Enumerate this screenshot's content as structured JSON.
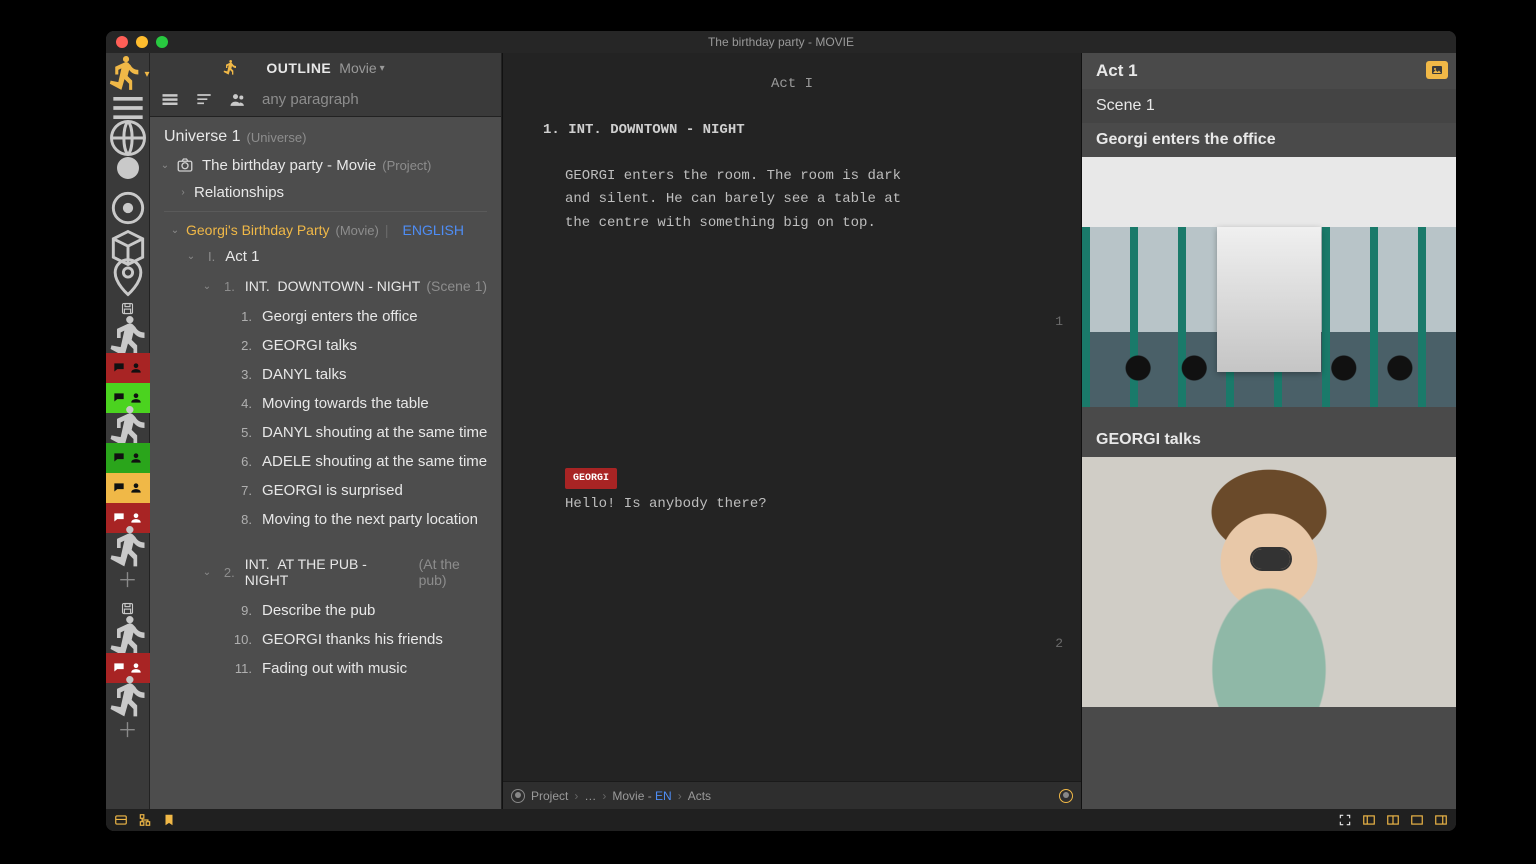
{
  "window": {
    "title": "The birthday party - MOVIE"
  },
  "outline": {
    "header_label": "OUTLINE",
    "header_mode": "Movie",
    "search_placeholder": "any paragraph"
  },
  "tree": {
    "universe": {
      "title": "Universe 1",
      "type": "(Universe)"
    },
    "project": {
      "title": "The birthday party - Movie",
      "type": "(Project)"
    },
    "relationships": "Relationships",
    "movie": {
      "title": "Georgi's Birthday Party",
      "type": "(Movie)",
      "language": "ENGLISH"
    },
    "act": {
      "roman": "I.",
      "title": "Act 1"
    },
    "scene1": {
      "num": "1.",
      "prefix": "INT.",
      "slug": "DOWNTOWN - NIGHT",
      "tag": "(Scene 1)"
    },
    "beats1": [
      {
        "n": "1.",
        "t": "Georgi enters the office"
      },
      {
        "n": "2.",
        "t": "GEORGI talks"
      },
      {
        "n": "3.",
        "t": "DANYL talks"
      },
      {
        "n": "4.",
        "t": "Moving towards the table"
      },
      {
        "n": "5.",
        "t": "DANYL shouting at the same time"
      },
      {
        "n": "6.",
        "t": "ADELE shouting at the same time"
      },
      {
        "n": "7.",
        "t": "GEORGI is surprised"
      },
      {
        "n": "8.",
        "t": "Moving to the next party location"
      }
    ],
    "scene2": {
      "num": "2.",
      "prefix": "INT.",
      "slug": "AT THE PUB - NIGHT",
      "tag": "(At the pub)"
    },
    "beats2": [
      {
        "n": "9.",
        "t": "Describe the pub"
      },
      {
        "n": "10.",
        "t": "GEORGI thanks his friends"
      },
      {
        "n": "11.",
        "t": "Fading out with music"
      }
    ]
  },
  "editor": {
    "act": "Act I",
    "scene_heading": "1.  INT. DOWNTOWN - NIGHT",
    "action": "GEORGI enters the room. The room is dark and silent. He can barely see a table at the centre with something big on top.",
    "page1": "1",
    "character": "GEORGI",
    "dialog": "Hello! Is anybody there?",
    "page2": "2"
  },
  "breadcrumb": {
    "b1": "Project",
    "b2": "…",
    "b3": "Movie - ",
    "b3b": "EN",
    "b4": "Acts"
  },
  "cards": {
    "act": "Act 1",
    "scene": "Scene 1",
    "card1_title": "Georgi enters the office",
    "card2_title": "GEORGI talks"
  },
  "rail_act_colors": {
    "c1": "#a82424",
    "c2": "#4bd31f",
    "c3": "#2aa51b",
    "c4": "#f0b847",
    "c5": "#a82424",
    "c6": "#a82424"
  }
}
